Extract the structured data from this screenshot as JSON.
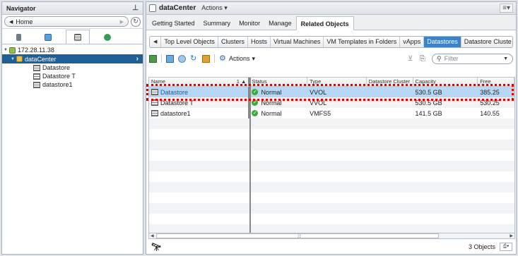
{
  "navigator": {
    "title": "Navigator",
    "home_label": "Home",
    "tree": {
      "host": "172.28.11.38",
      "datacenter": "dataCenter",
      "datastores": [
        "Datastore",
        "Datastore T",
        "datastore1"
      ]
    }
  },
  "main": {
    "title": "dataCenter",
    "actions_label": "Actions",
    "tabs": [
      "Getting Started",
      "Summary",
      "Monitor",
      "Manage",
      "Related Objects"
    ],
    "active_tab": "Related Objects",
    "subtabs": [
      "Top Level Objects",
      "Clusters",
      "Hosts",
      "Virtual Machines",
      "VM Templates in Folders",
      "vApps",
      "Datastores",
      "Datastore Cluste"
    ],
    "active_subtab": "Datastores",
    "toolbar_actions_label": "Actions",
    "filter_placeholder": "Filter",
    "columns": [
      "Name",
      "Status",
      "Type",
      "Datastore Cluster",
      "Capacity",
      "Free"
    ],
    "sort_indicator": "1",
    "rows": [
      {
        "name": "Datastore",
        "status": "Normal",
        "type": "VVOL",
        "cluster": "",
        "capacity": "530.5 GB",
        "free": "385.25",
        "selected": true
      },
      {
        "name": "Datastore T",
        "status": "Normal",
        "type": "VVOL",
        "cluster": "",
        "capacity": "530.5 GB",
        "free": "530.25",
        "selected": false
      },
      {
        "name": "datastore1",
        "status": "Normal",
        "type": "VMFS5",
        "cluster": "",
        "capacity": "141.5 GB",
        "free": "140.55",
        "selected": false
      }
    ],
    "object_count": "3 Objects"
  },
  "colors": {
    "accent": "#3b82c6",
    "selected_row": "#b6d8f5",
    "tree_selected": "#1e5f96",
    "highlight": "#e00000",
    "status_ok": "#3aa83a"
  }
}
